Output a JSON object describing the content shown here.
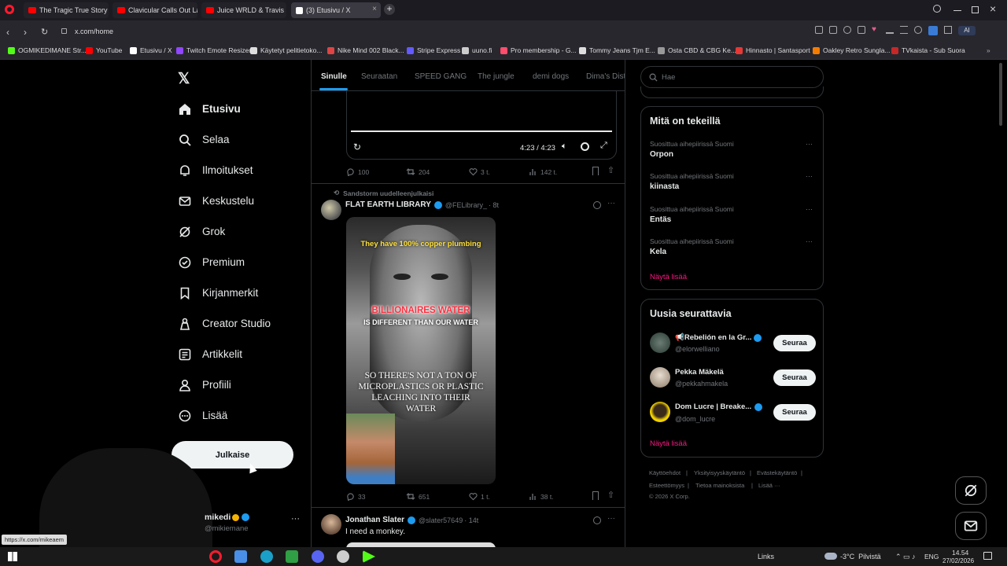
{
  "browser": {
    "tabs": [
      {
        "title": "The Tragic True Story of Ju",
        "color": "#ff0000"
      },
      {
        "title": "Clavicular Calls Out Larry",
        "color": "#ff0000"
      },
      {
        "title": "Juice WRLD & Travis Scott",
        "color": "#ff0000"
      },
      {
        "title": "(3) Etusivu / X",
        "color": "#ffffff"
      }
    ],
    "url": "x.com/home",
    "status_url": "https://x.com/mikeaem",
    "bookmarks": [
      {
        "label": "OGMIKEDIMANE Str...",
        "color": "#53fc18"
      },
      {
        "label": "YouTube",
        "color": "#ff0000"
      },
      {
        "label": "Etusivu / X",
        "color": "#ffffff"
      },
      {
        "label": "Twitch Emote Resizer",
        "color": "#9146ff"
      },
      {
        "label": "Käytetyt pelitietoko...",
        "color": "#dddddd"
      },
      {
        "label": "Nike Mind 002 Black...",
        "color": "#dd4444"
      },
      {
        "label": "Stripe Express",
        "color": "#635bff"
      },
      {
        "label": "uuno.fi",
        "color": "#cccccc"
      },
      {
        "label": "Pro membership - G...",
        "color": "#ff4d6d"
      },
      {
        "label": "Tommy Jeans Tjm E...",
        "color": "#dddddd"
      },
      {
        "label": "Osta CBD & CBG Ke...",
        "color": "#999999"
      },
      {
        "label": "Hinnasto | Santasport",
        "color": "#e53935"
      },
      {
        "label": "Oakley Retro Sungla...",
        "color": "#f57c00"
      },
      {
        "label": "TVkaista - Sub Suora",
        "color": "#c62828"
      }
    ]
  },
  "nav": {
    "items": [
      {
        "label": "Etusivu",
        "icon": "home-icon"
      },
      {
        "label": "Selaa",
        "icon": "search-icon"
      },
      {
        "label": "Ilmoitukset",
        "icon": "bell-icon"
      },
      {
        "label": "Keskustelu",
        "icon": "mail-icon"
      },
      {
        "label": "Grok",
        "icon": "grok-icon"
      },
      {
        "label": "Premium",
        "icon": "verified-icon"
      },
      {
        "label": "Kirjanmerkit",
        "icon": "bookmark-icon"
      },
      {
        "label": "Creator Studio",
        "icon": "creator-icon"
      },
      {
        "label": "Artikkelit",
        "icon": "article-icon"
      },
      {
        "label": "Profiili",
        "icon": "user-icon"
      },
      {
        "label": "Lisää",
        "icon": "more-circle-icon"
      }
    ],
    "post_button": "Julkaise",
    "account": {
      "name": "mikedi",
      "handle": "@mikiemane"
    }
  },
  "feed": {
    "tabs": [
      "Sinulle",
      "Seuraatan",
      "SPEED GANG",
      "The jungle",
      "demi dogs",
      "Dima's Dist"
    ],
    "video_time": "4:23 / 4:23",
    "prev_actions": {
      "replies": "100",
      "reposts": "204",
      "likes": "3 t.",
      "views": "142 t."
    },
    "post": {
      "repost_by": "Sandstorm uudelleenjulkaisi",
      "name": "FLAT EARTH LIBRARY",
      "handle": "@FELibrary_",
      "time": "· 8t",
      "caption_top": "They have 100% copper plumbing",
      "caption_red": "BILLIONAIRES WATER",
      "caption_white": "IS DIFFERENT THAN OUR WATER",
      "caption_bottom": "SO THERE'S NOT A TON OF MICROPLASTICS OR PLASTIC LEACHING INTO THEIR WATER",
      "replies": "33",
      "reposts": "651",
      "likes": "1 t.",
      "views": "38 t."
    },
    "next_post": {
      "name": "Jonathan Slater",
      "handle": "@slater57649",
      "time": "· 14t",
      "text": "I need a monkey."
    }
  },
  "sidebar": {
    "search_placeholder": "Hae",
    "trends_title": "Mitä on tekeillä",
    "trends": [
      {
        "context": "Suosittua aihepiirissä Suomi",
        "name": "Orpon"
      },
      {
        "context": "Suosittua aihepiirissä Suomi",
        "name": "kiinasta"
      },
      {
        "context": "Suosittua aihepiirissä Suomi",
        "name": "Entäs"
      },
      {
        "context": "Suosittua aihepiirissä Suomi",
        "name": "Kela"
      }
    ],
    "show_more": "Näytä lisää",
    "follow_title": "Uusia seurattavia",
    "follow": [
      {
        "name": "📢Rebelión en la Gr...",
        "handle": "@elorwelliano"
      },
      {
        "name": "Pekka Mäkelä",
        "handle": "@pekkahmakela"
      },
      {
        "name": "Dom Lucre | Breake...",
        "handle": "@dom_lucre"
      }
    ],
    "follow_label": "Seuraa",
    "footer": [
      "Käyttöehdot",
      "Yksityisyyskäytäntö",
      "Evästekäytäntö",
      "Esteettömyys",
      "Tietoa mainoksista",
      "Lisää ···",
      "© 2026 X Corp."
    ]
  },
  "taskbar": {
    "links": "Links",
    "weather": "-3°C  Pilvistä",
    "lang": "ENG",
    "time": "14.54",
    "date": "27/02/2026"
  }
}
